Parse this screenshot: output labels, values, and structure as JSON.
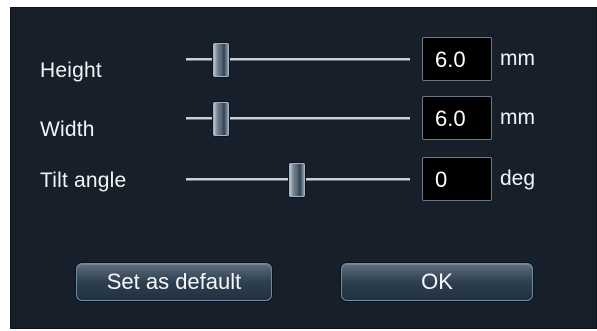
{
  "rows": [
    {
      "label": "Height",
      "value": "6.0",
      "unit": "mm",
      "slider_fraction": 0.15
    },
    {
      "label": "Width",
      "value": "6.0",
      "unit": "mm",
      "slider_fraction": 0.15
    },
    {
      "label": "Tilt angle",
      "value": "0",
      "unit": "deg",
      "slider_fraction": 0.49
    }
  ],
  "buttons": {
    "set_default_label": "Set as default",
    "ok_label": "OK"
  },
  "colors": {
    "background": "#161f2a",
    "field_background": "#000000",
    "text": "#f2f4f6",
    "button_gradient_top": "#5b6d7f",
    "button_gradient_bottom": "#213141"
  }
}
